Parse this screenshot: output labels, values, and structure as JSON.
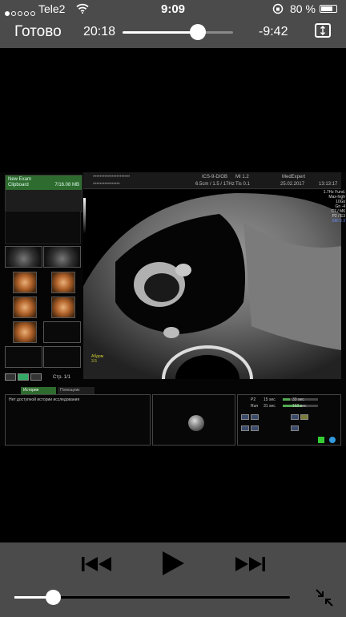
{
  "status_bar": {
    "carrier": "Tele2",
    "signal_bars_filled": 1,
    "signal_bars_total": 5,
    "time": "9:09",
    "battery": "80 %",
    "battery_level": 0.8,
    "icons": [
      "wifi-icon",
      "orientation-lock-icon",
      "battery-icon"
    ]
  },
  "player_top": {
    "done_label": "Готово",
    "elapsed": "20:18",
    "remaining": "-9:42",
    "progress": 0.68
  },
  "ultrasound": {
    "left_header_line1": "New Exam",
    "left_header_line2": "Clipboard",
    "left_header_size": "7/16.08 MB",
    "page_label": "Стр. 1/1",
    "header_code": "ICS-9-D/OB",
    "mi": "MI 1.2",
    "tis": "Tis 0.1",
    "probe_info": "6.5cm / 1.5 / 17Hz",
    "clinic": "MedExpert",
    "date": "25.02.2017",
    "time": "13:13:17",
    "params": [
      "1.7Hz Fund.",
      "Max-high",
      "10Gs",
      "Gn -4",
      "C7 / M6",
      "P2 / E3"
    ],
    "params_highlight": "SRI II 3",
    "depth_label_1": "Абдом",
    "depth_label_2": "3.5",
    "tab_active": "История исслед.",
    "tab_inactive": "Помощник сканирова",
    "history_text": "Нет доступной истории исследования",
    "scan_rows": [
      {
        "label": "P2",
        "time": "15 sec",
        "right": "33 sec",
        "fill": 0.2
      },
      {
        "label": "Run",
        "time": "31 sec",
        "right": "163 sec",
        "fill": 0.55
      }
    ]
  },
  "player_bottom": {
    "volume": 0.14,
    "icons": [
      "previous-icon",
      "play-icon",
      "next-icon",
      "exit-fullscreen-icon"
    ]
  }
}
